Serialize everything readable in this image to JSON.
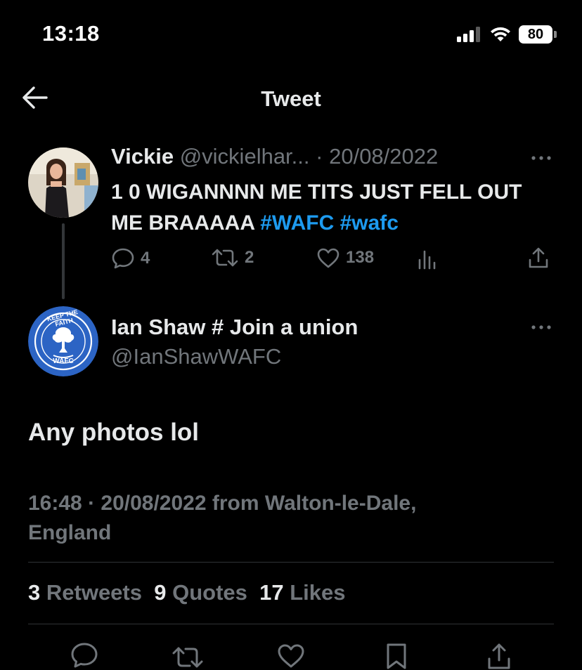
{
  "status_bar": {
    "time": "13:18",
    "battery": "80"
  },
  "header": {
    "title": "Tweet"
  },
  "parent_tweet": {
    "name": "Vickie",
    "handle": "@vickielhar...",
    "separator": "·",
    "date": "20/08/2022",
    "text_plain": "1 0 WIGANNNN ME TITS JUST FELL OUT ME BRAAAAA",
    "hashtags": [
      "#WAFC",
      "#wafc"
    ],
    "replies": "4",
    "retweets": "2",
    "likes": "138"
  },
  "reply_tweet": {
    "name": "Ian Shaw # Join a union",
    "handle": "@IanShawWAFC",
    "avatar_text_top": "KEEP THE FAITH",
    "avatar_text_bottom": "WAFC",
    "text": "Any photos lol",
    "timestamp_line1": "16:48 · 20/08/2022 from Walton-le-Dale,",
    "timestamp_line2": "England"
  },
  "stats": {
    "retweets_count": "3",
    "retweets_label": "Retweets",
    "quotes_count": "9",
    "quotes_label": "Quotes",
    "likes_count": "17",
    "likes_label": "Likes"
  },
  "colors": {
    "background": "#000000",
    "text": "#e7e9ea",
    "muted": "#71767b",
    "link": "#1d9bf0",
    "avatar_blue": "#2c64c4"
  }
}
